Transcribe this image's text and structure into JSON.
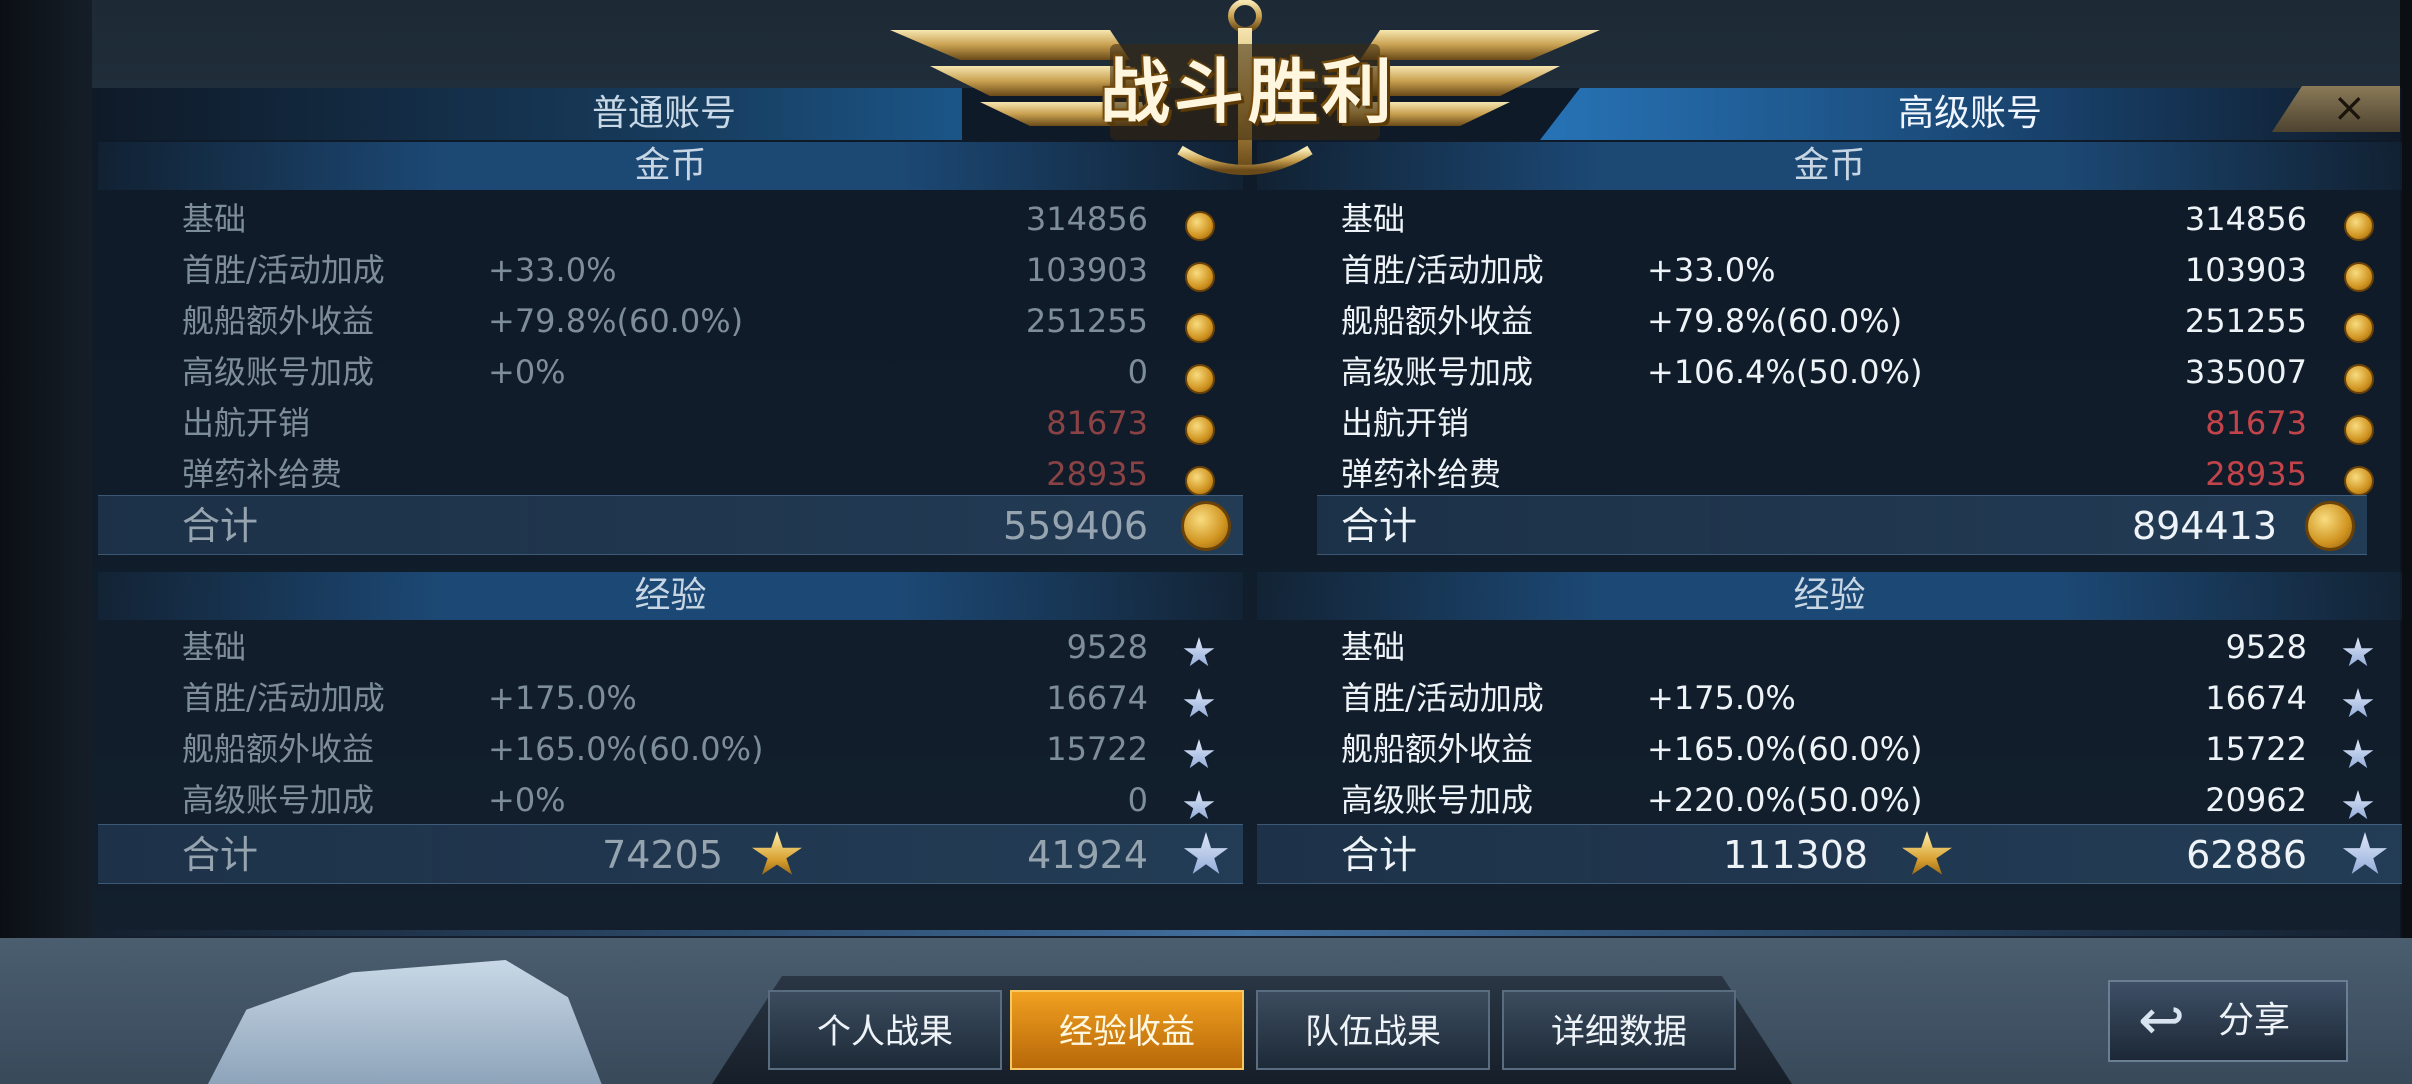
{
  "banner": {
    "title": "战斗胜利"
  },
  "tabs": {
    "normal": "普通账号",
    "premium": "高级账号"
  },
  "close_label": "×",
  "left": {
    "gold": {
      "header": "金币",
      "rows": [
        {
          "label": "基础",
          "pct": "",
          "value": "314856",
          "red": false
        },
        {
          "label": "首胜/活动加成",
          "pct": "+33.0%",
          "value": "103903",
          "red": false
        },
        {
          "label": "舰船额外收益",
          "pct": "+79.8%(60.0%)",
          "value": "251255",
          "red": false
        },
        {
          "label": "高级账号加成",
          "pct": "+0%",
          "value": "0",
          "red": false
        },
        {
          "label": "出航开销",
          "pct": "",
          "value": "81673",
          "red": true
        },
        {
          "label": "弹药补给费",
          "pct": "",
          "value": "28935",
          "red": true
        }
      ],
      "total_label": "合计",
      "total_value": "559406"
    },
    "exp": {
      "header": "经验",
      "rows": [
        {
          "label": "基础",
          "pct": "",
          "value": "9528"
        },
        {
          "label": "首胜/活动加成",
          "pct": "+175.0%",
          "value": "16674"
        },
        {
          "label": "舰船额外收益",
          "pct": "+165.0%(60.0%)",
          "value": "15722"
        },
        {
          "label": "高级账号加成",
          "pct": "+0%",
          "value": "0"
        }
      ],
      "total_label": "合计",
      "total_captain": "74205",
      "total_value": "41924"
    }
  },
  "right": {
    "gold": {
      "header": "金币",
      "rows": [
        {
          "label": "基础",
          "pct": "",
          "value": "314856",
          "red": false
        },
        {
          "label": "首胜/活动加成",
          "pct": "+33.0%",
          "value": "103903",
          "red": false
        },
        {
          "label": "舰船额外收益",
          "pct": "+79.8%(60.0%)",
          "value": "251255",
          "red": false
        },
        {
          "label": "高级账号加成",
          "pct": "+106.4%(50.0%)",
          "value": "335007",
          "red": false
        },
        {
          "label": "出航开销",
          "pct": "",
          "value": "81673",
          "red": true
        },
        {
          "label": "弹药补给费",
          "pct": "",
          "value": "28935",
          "red": true
        }
      ],
      "total_label": "合计",
      "total_value": "894413"
    },
    "exp": {
      "header": "经验",
      "rows": [
        {
          "label": "基础",
          "pct": "",
          "value": "9528"
        },
        {
          "label": "首胜/活动加成",
          "pct": "+175.0%",
          "value": "16674"
        },
        {
          "label": "舰船额外收益",
          "pct": "+165.0%(60.0%)",
          "value": "15722"
        },
        {
          "label": "高级账号加成",
          "pct": "+220.0%(50.0%)",
          "value": "20962"
        }
      ],
      "total_label": "合计",
      "total_captain": "111308",
      "total_value": "62886"
    }
  },
  "nav": [
    "个人战果",
    "经验收益",
    "队伍战果",
    "详细数据"
  ],
  "nav_active": 1,
  "share": {
    "label": "分享"
  },
  "colors": {
    "negative": "#c2444a",
    "active_tab": "#f0a020",
    "coin": "#d09420"
  },
  "icons": {
    "gold": "coin-icon",
    "exp": "star-icon",
    "captain_exp": "gold-star-icon",
    "share": "share-arrow-icon",
    "close": "close-icon"
  }
}
